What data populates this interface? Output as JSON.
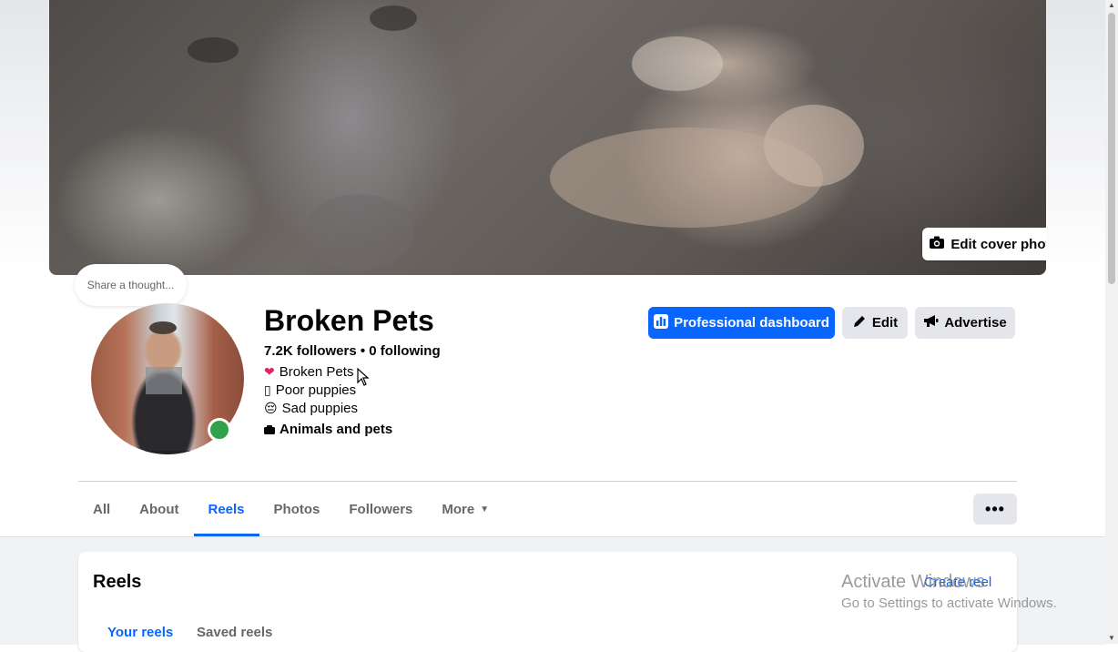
{
  "cover": {
    "edit_label": "Edit cover photo"
  },
  "thought_bubble": "Share a thought...",
  "profile": {
    "name": "Broken Pets",
    "stats": "7.2K followers • 0 following",
    "bio": [
      {
        "icon": "❤",
        "text": "Broken Pets"
      },
      {
        "icon": "▯",
        "text": "Poor puppies"
      },
      {
        "icon": "😔",
        "text": "Sad puppies"
      },
      {
        "icon": "▬",
        "text": "Animals and pets"
      }
    ]
  },
  "actions": {
    "professional_dashboard": "Professional dashboard",
    "edit": "Edit",
    "advertise": "Advertise"
  },
  "tabs": [
    {
      "label": "All"
    },
    {
      "label": "About"
    },
    {
      "label": "Reels",
      "active": true
    },
    {
      "label": "Photos"
    },
    {
      "label": "Followers"
    },
    {
      "label": "More"
    }
  ],
  "more_menu_label": "•••",
  "reels_card": {
    "title": "Reels",
    "create_label": "Create reel",
    "subtabs": [
      {
        "label": "Your reels",
        "active": true
      },
      {
        "label": "Saved reels"
      }
    ]
  },
  "watermark": {
    "line1": "Activate Windows",
    "line2": "Go to Settings to activate Windows."
  },
  "colors": {
    "accent": "#0866ff",
    "online": "#31a24c",
    "button_gray": "#e4e6eb"
  }
}
